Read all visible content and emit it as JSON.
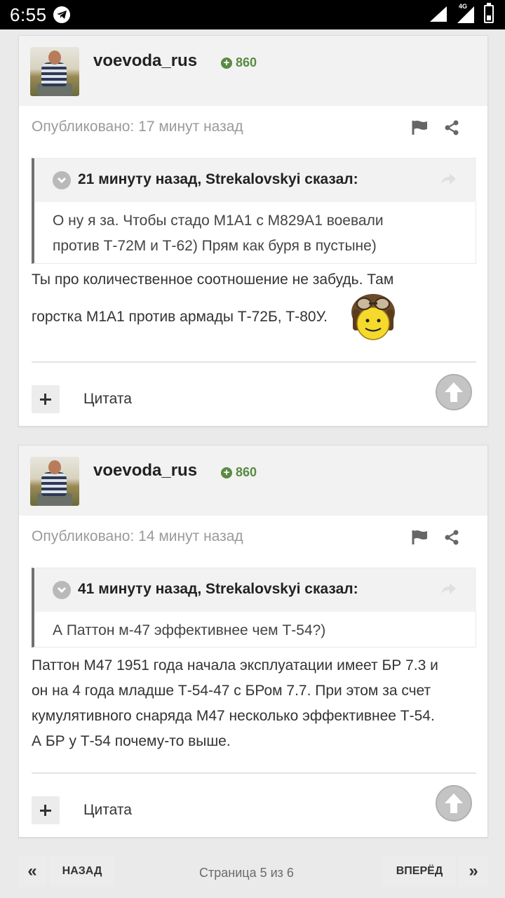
{
  "status_bar": {
    "time": "6:55",
    "network": "4G"
  },
  "posts": [
    {
      "username": "voevoda_rus",
      "reputation": "860",
      "published": "Опубликовано: 17 минут назад",
      "quote": {
        "header": "21 минуту назад, Strekalovskyi сказал:",
        "lines": [
          "О ну я за. Чтобы стадо М1А1 с М829А1 воевали",
          "против Т-72М и Т-62) Прям как буря в пустыне)"
        ]
      },
      "lines": [
        "Ты про количественное соотношение не забудь. Там",
        "горстка М1А1 против армады Т-72Б, Т-80У."
      ],
      "quote_button": "Цитата"
    },
    {
      "username": "voevoda_rus",
      "reputation": "860",
      "published": "Опубликовано: 14 минут назад",
      "quote": {
        "header": "41 минуту назад, Strekalovskyi сказал:",
        "lines": [
          "А Паттон м-47 эффективнее чем Т-54?)"
        ]
      },
      "lines": [
        "Паттон М47 1951 года начала эксплуатации имеет БР 7.3 и",
        "он  на 4 года младше Т-54-47 с БРом 7.7. При этом за счет",
        "кумулятивного снаряда М47 несколько эффективнее Т-54.",
        "А БР у Т-54 почему-то выше."
      ],
      "quote_button": "Цитата"
    }
  ],
  "pagination": {
    "back": "НАЗАД",
    "forward": "ВПЕРЁД",
    "info": "Страница 5 из 6",
    "first_icon": "«",
    "last_icon": "»"
  }
}
